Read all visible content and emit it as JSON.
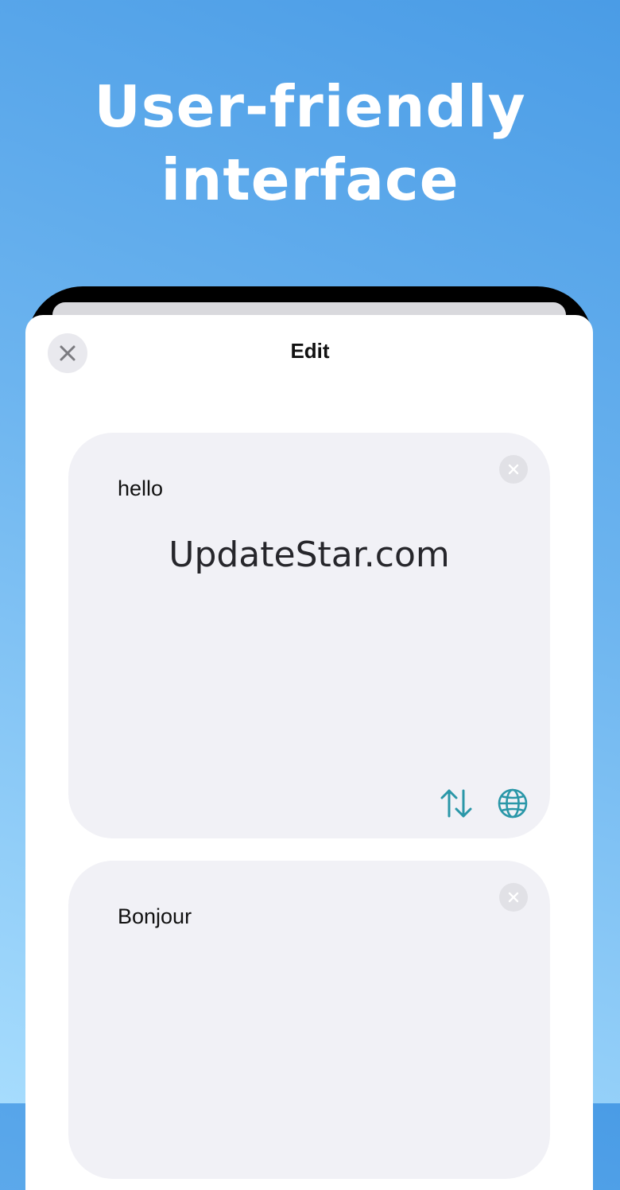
{
  "headline": {
    "line1": "User-friendly",
    "line2": "interface"
  },
  "sheet": {
    "title": "Edit"
  },
  "source_card": {
    "text": "hello",
    "watermark": "UpdateStar.com"
  },
  "target_card": {
    "text": "Bonjour"
  },
  "icons": {
    "close": "close-icon",
    "clear": "clear-icon",
    "swap": "swap-arrows-icon",
    "language": "globe-icon"
  },
  "colors": {
    "accent": "#2a97a8",
    "background_top": "#4a9ce6",
    "background_bottom": "#a6dcfd"
  }
}
